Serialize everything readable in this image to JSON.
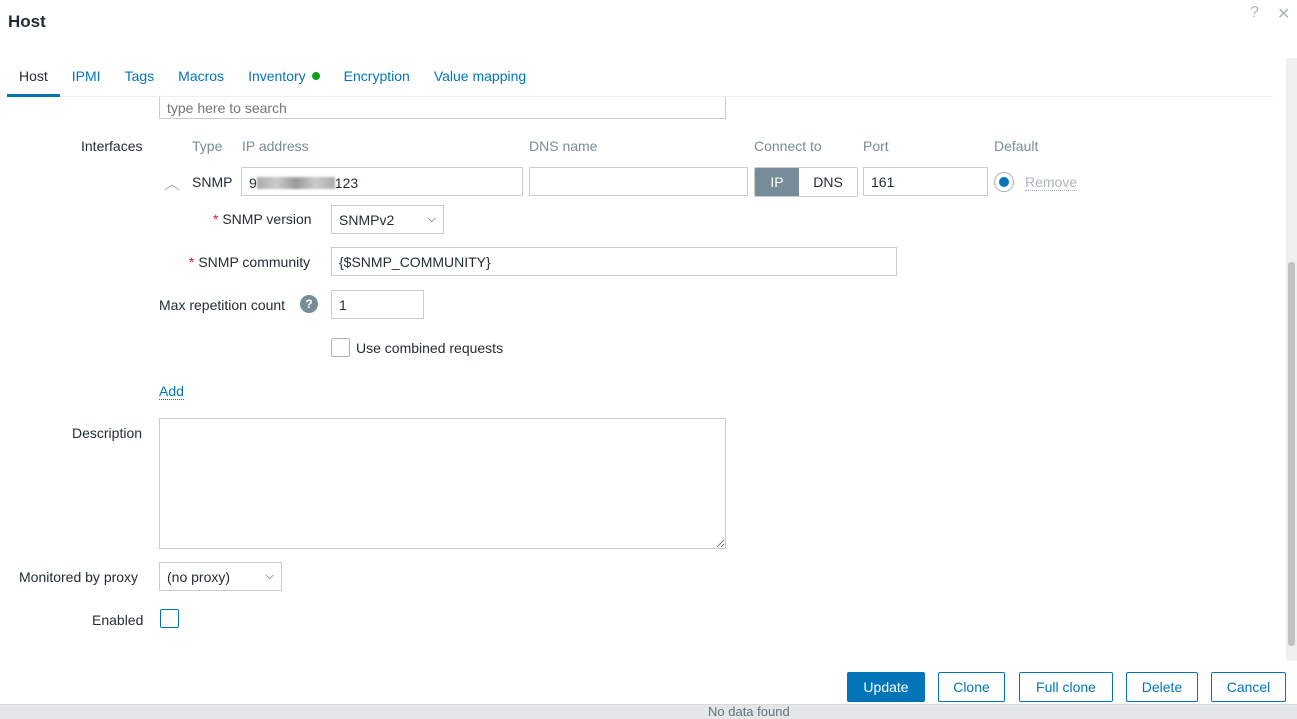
{
  "dialog": {
    "title": "Host",
    "help_icon": "?",
    "close_icon": "✕"
  },
  "tabs": [
    {
      "label": "Host"
    },
    {
      "label": "IPMI"
    },
    {
      "label": "Tags"
    },
    {
      "label": "Macros"
    },
    {
      "label": "Inventory"
    },
    {
      "label": "Encryption"
    },
    {
      "label": "Value mapping"
    }
  ],
  "search": {
    "placeholder": "type here to search"
  },
  "interfaces": {
    "label": "Interfaces",
    "headers": {
      "type": "Type",
      "ip": "IP address",
      "dns": "DNS name",
      "connect": "Connect to",
      "port": "Port",
      "default": "Default"
    },
    "row": {
      "type": "SNMP",
      "ip_prefix": "9",
      "ip_suffix": "123",
      "dns": "",
      "connect_ip": "IP",
      "connect_dns": "DNS",
      "port": "161",
      "remove": "Remove"
    },
    "snmp_version_label": "SNMP version",
    "snmp_version": "SNMPv2",
    "snmp_community_label": "SNMP community",
    "snmp_community": "{$SNMP_COMMUNITY}",
    "max_rep_label": "Max repetition count",
    "max_rep": "1",
    "combined_label": "Use combined requests",
    "add": "Add"
  },
  "description": {
    "label": "Description",
    "value": ""
  },
  "proxy": {
    "label": "Monitored by proxy",
    "value": "(no proxy)"
  },
  "enabled": {
    "label": "Enabled"
  },
  "buttons": {
    "update": "Update",
    "clone": "Clone",
    "full_clone": "Full clone",
    "delete": "Delete",
    "cancel": "Cancel"
  },
  "background": {
    "text": "No data found"
  }
}
